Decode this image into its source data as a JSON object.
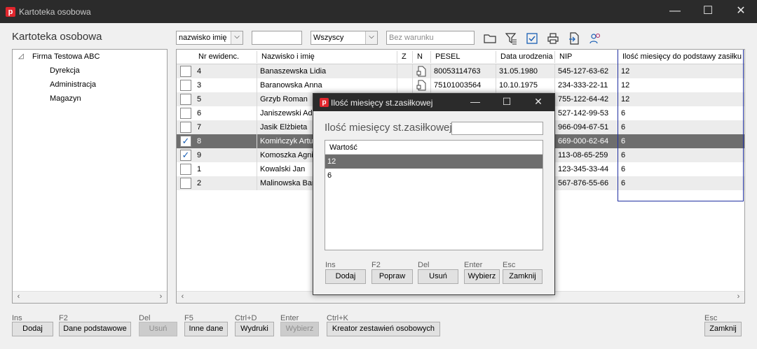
{
  "window": {
    "title": "Kartoteka osobowa",
    "minimize": "—",
    "maximize": "☐",
    "close": "✕"
  },
  "page_title": "Kartoteka osobowa",
  "toolbar": {
    "sort_select": "nazwisko imię",
    "search_value": "",
    "filter_select": "Wszyscy",
    "condition_placeholder": "Bez warunku",
    "icons": [
      "folder-icon",
      "filter-icon",
      "check-all-icon",
      "print-icon",
      "export-icon",
      "users-icon"
    ]
  },
  "tree": {
    "root": "Firma Testowa ABC",
    "children": [
      "Dyrekcja",
      "Administracja",
      "Magazyn"
    ]
  },
  "grid": {
    "columns": [
      "Nr ewidenc.",
      "Nazwisko i imię",
      "Z",
      "N",
      "PESEL",
      "Data urodzenia",
      "NIP",
      "Ilość miesięcy do podstawy zasiłku"
    ],
    "rows": [
      {
        "checked": false,
        "nr": "4",
        "name": "Banaszewska Lidia",
        "pesel": "80053114763",
        "birth": "31.05.1980",
        "nip": "545-127-63-62",
        "months": "12",
        "doc": true
      },
      {
        "checked": false,
        "nr": "3",
        "name": "Baranowska Anna",
        "pesel": "75101003564",
        "birth": "10.10.1975",
        "nip": "234-333-22-11",
        "months": "12",
        "doc": true
      },
      {
        "checked": false,
        "nr": "5",
        "name": "Grzyb Roman",
        "pesel": "",
        "birth": "",
        "nip": "755-122-64-42",
        "months": "12",
        "doc": false
      },
      {
        "checked": false,
        "nr": "6",
        "name": "Janiszewski Ada",
        "pesel": "",
        "birth": "",
        "nip": "527-142-99-53",
        "months": "6",
        "doc": false
      },
      {
        "checked": false,
        "nr": "7",
        "name": "Jasik Elżbieta",
        "pesel": "",
        "birth": "",
        "nip": "966-094-67-51",
        "months": "6",
        "doc": false
      },
      {
        "checked": true,
        "nr": "8",
        "name": "Komińczyk Artur",
        "pesel": "",
        "birth": "",
        "nip": "669-000-62-64",
        "months": "6",
        "doc": false,
        "selected": true
      },
      {
        "checked": true,
        "nr": "9",
        "name": "Komoszka Agnie",
        "pesel": "",
        "birth": "",
        "nip": "113-08-65-259",
        "months": "6",
        "doc": false
      },
      {
        "checked": false,
        "nr": "1",
        "name": "Kowalski Jan",
        "pesel": "",
        "birth": "",
        "nip": "123-345-33-44",
        "months": "6",
        "doc": false
      },
      {
        "checked": false,
        "nr": "2",
        "name": "Malinowska Bark",
        "pesel": "",
        "birth": "",
        "nip": "567-876-55-66",
        "months": "6",
        "doc": false
      }
    ]
  },
  "bottom_buttons": [
    {
      "shortcut": "Ins",
      "label": "Dodaj",
      "disabled": false
    },
    {
      "shortcut": "F2",
      "label": "Dane podstawowe",
      "disabled": false
    },
    {
      "shortcut": "Del",
      "label": "Usuń",
      "disabled": true
    },
    {
      "shortcut": "F5",
      "label": "Inne dane",
      "disabled": false
    },
    {
      "shortcut": "Ctrl+D",
      "label": "Wydruki",
      "disabled": false
    },
    {
      "shortcut": "Enter",
      "label": "Wybierz",
      "disabled": true
    },
    {
      "shortcut": "Ctrl+K",
      "label": "Kreator zestawień osobowych",
      "disabled": false
    },
    {
      "shortcut": "Esc",
      "label": "Zamknij",
      "disabled": false
    }
  ],
  "dialog": {
    "title": "Ilość miesięcy st.zasiłkowej",
    "field_label": "Ilość miesięcy st.zasiłkowej",
    "field_value": "",
    "list_header": "Wartość",
    "list_items": [
      "12",
      "6"
    ],
    "selected_index": 0,
    "buttons": [
      {
        "shortcut": "Ins",
        "label": "Dodaj"
      },
      {
        "shortcut": "F2",
        "label": "Popraw"
      },
      {
        "shortcut": "Del",
        "label": "Usuń"
      },
      {
        "shortcut": "Enter",
        "label": "Wybierz"
      },
      {
        "shortcut": "Esc",
        "label": "Zamknij"
      }
    ]
  }
}
